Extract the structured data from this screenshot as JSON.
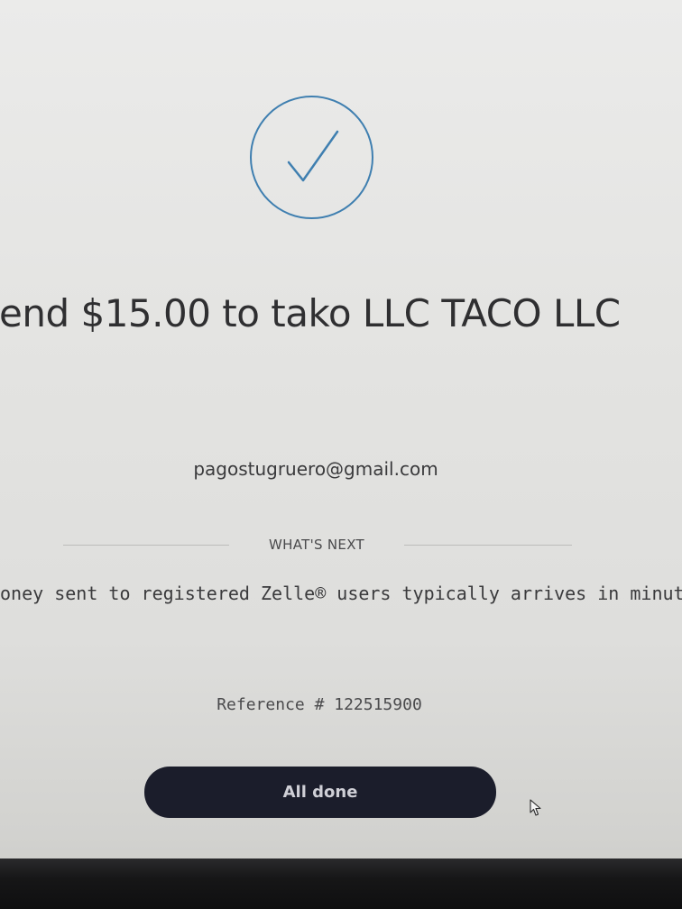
{
  "confirmation": {
    "headline": "end $15.00 to tako LLC TACO LLC",
    "recipient_email": "pagostugruero@gmail.com",
    "whats_next_label": "WHAT'S NEXT",
    "info_text": "oney sent to registered Zelle® users typically arrives in minutes",
    "reference": "Reference # 122515900",
    "done_button_label": "All done"
  },
  "icons": {
    "status": "checkmark-circle-icon",
    "cursor": "mouse-pointer-icon"
  },
  "colors": {
    "accent": "#3f7fb0",
    "button_background": "#1b1d2b",
    "button_text": "#cfcfd6",
    "text": "#2f2f31"
  }
}
